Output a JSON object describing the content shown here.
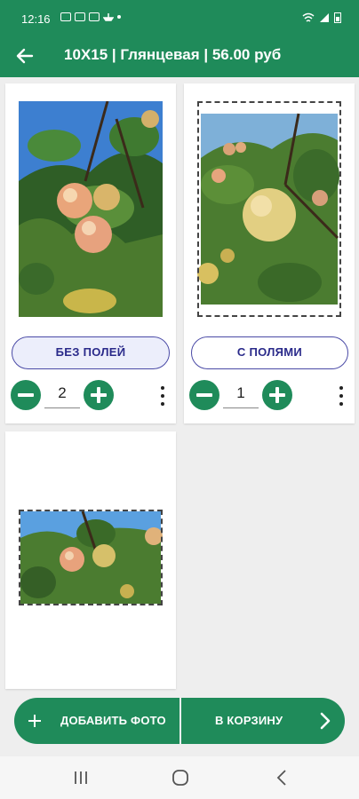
{
  "status_bar": {
    "time": "12:16"
  },
  "app_bar": {
    "title": "10X15 | Глянцевая | 56.00 руб"
  },
  "cards": [
    {
      "mode_label": "БЕЗ ПОЛЕЙ",
      "mode_active": true,
      "quantity": "2"
    },
    {
      "mode_label": "С ПОЛЯМИ",
      "mode_active": false,
      "quantity": "1"
    }
  ],
  "bottom_bar": {
    "add_photo_label": "ДОБАВИТЬ ФОТО",
    "cart_label": "В КОРЗИНУ"
  },
  "colors": {
    "primary": "#1f8b5a",
    "outline_button": "#4a4aa6",
    "background": "#eeeeee"
  },
  "icons": [
    "back-arrow-icon",
    "minus-icon",
    "plus-icon",
    "more-vertical-icon",
    "chevron-right-icon",
    "recents-icon",
    "home-icon",
    "back-nav-icon"
  ]
}
